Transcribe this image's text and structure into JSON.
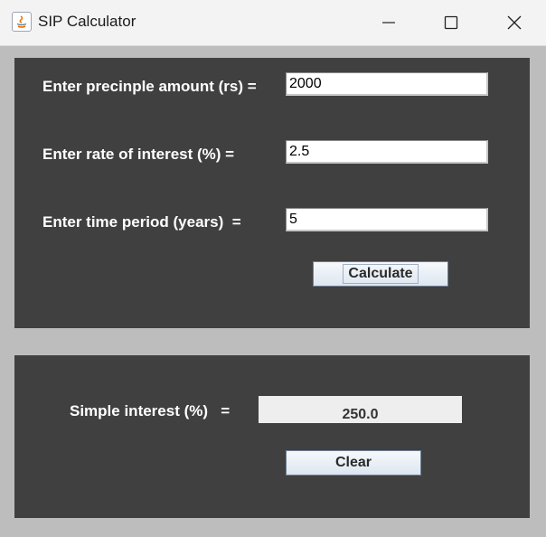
{
  "window": {
    "title": "SIP Calculator",
    "icon": "java-app-icon"
  },
  "form": {
    "principal_label": "Enter precinple amount (rs) =",
    "principal_value": "2000",
    "rate_label": "Enter rate of interest (%) =",
    "rate_value": "2.5",
    "time_label": "Enter time period (years)  =",
    "time_value": "5",
    "calculate_label": "Calculate"
  },
  "result": {
    "label": "Simple interest (%)   =",
    "value": "250.0",
    "clear_label": "Clear"
  },
  "colors": {
    "panel_background": "#404040",
    "frame_background": "#bdbdbd",
    "label_text": "#ffffff"
  }
}
